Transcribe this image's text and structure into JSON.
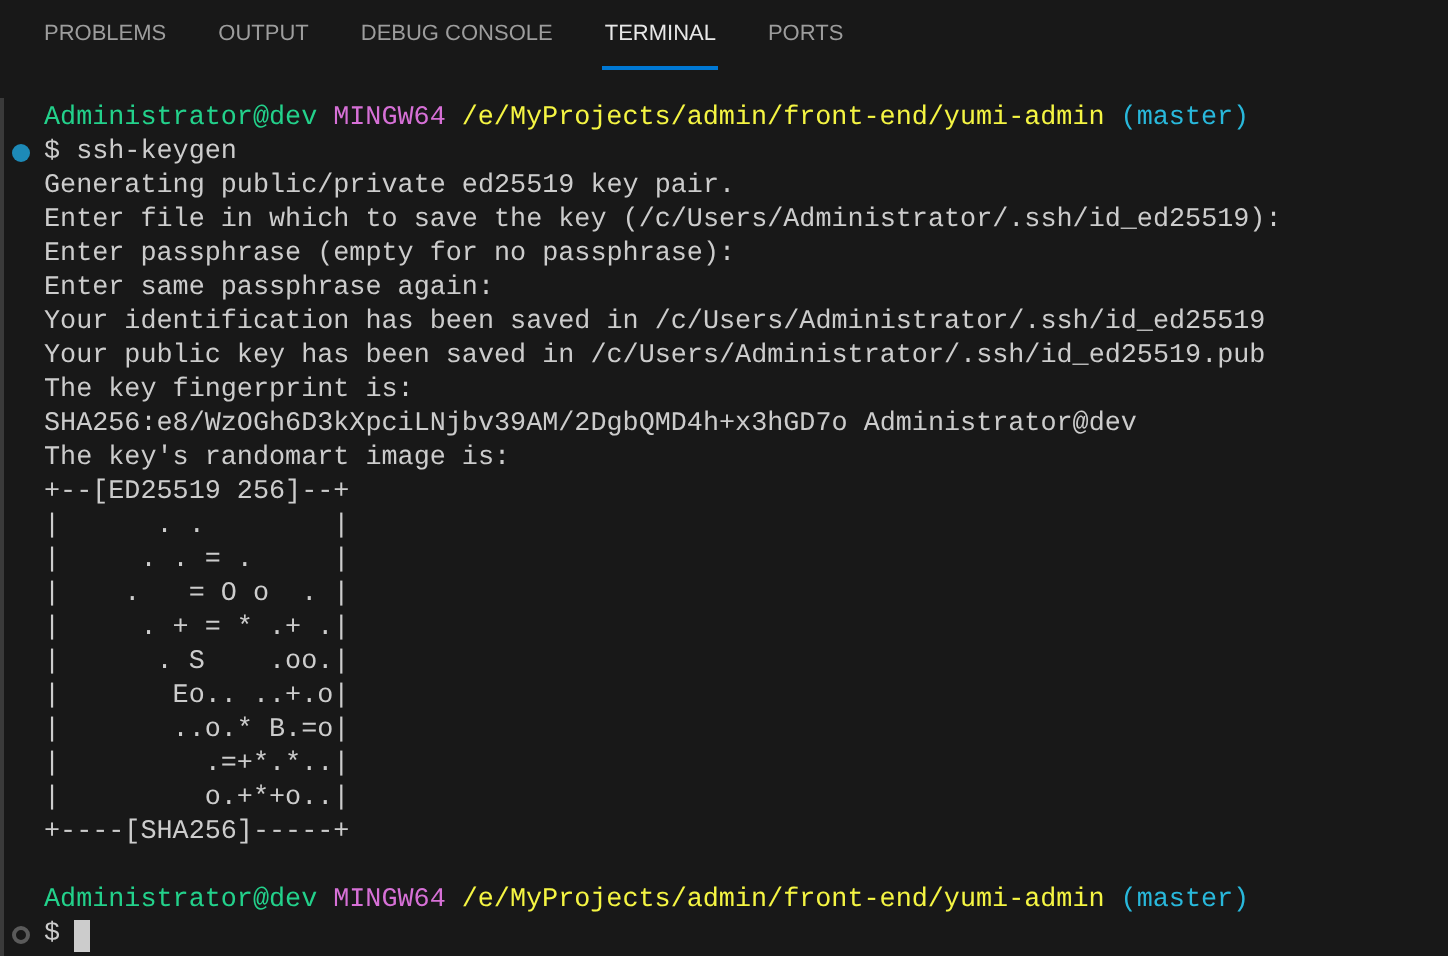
{
  "tabs": [
    {
      "label": "PROBLEMS",
      "selected": false
    },
    {
      "label": "OUTPUT",
      "selected": false
    },
    {
      "label": "DEBUG CONSOLE",
      "selected": false
    },
    {
      "label": "TERMINAL",
      "selected": true
    },
    {
      "label": "PORTS",
      "selected": false
    }
  ],
  "terminal": {
    "lines": [
      {
        "kind": "prompt",
        "segments": [
          {
            "text": "Administrator@dev",
            "color": "#23d18b"
          },
          {
            "text": "MINGW64",
            "color": "#d670d6"
          },
          {
            "text": "/e/MyProjects/admin/front-end/yumi-admin",
            "color": "#f5f543"
          },
          {
            "text": "(master)",
            "color": "#29b8db"
          }
        ]
      },
      {
        "kind": "command",
        "succeeded": true,
        "text": "$ ssh-keygen",
        "cursor": false
      },
      {
        "kind": "output",
        "text": "Generating public/private ed25519 key pair."
      },
      {
        "kind": "output",
        "text": "Enter file in which to save the key (/c/Users/Administrator/.ssh/id_ed25519):"
      },
      {
        "kind": "output",
        "text": "Enter passphrase (empty for no passphrase):"
      },
      {
        "kind": "output",
        "text": "Enter same passphrase again:"
      },
      {
        "kind": "output",
        "text": "Your identification has been saved in /c/Users/Administrator/.ssh/id_ed25519"
      },
      {
        "kind": "output",
        "text": "Your public key has been saved in /c/Users/Administrator/.ssh/id_ed25519.pub"
      },
      {
        "kind": "output",
        "text": "The key fingerprint is:"
      },
      {
        "kind": "output",
        "text": "SHA256:e8/WzOGh6D3kXpciLNjbv39AM/2DgbQMD4h+x3hGD7o Administrator@dev"
      },
      {
        "kind": "output",
        "text": "The key's randomart image is:"
      },
      {
        "kind": "output",
        "text": "+--[ED25519 256]--+"
      },
      {
        "kind": "output",
        "text": "|      . .        |"
      },
      {
        "kind": "output",
        "text": "|     . . = .     |"
      },
      {
        "kind": "output",
        "text": "|    .   = O o  . |"
      },
      {
        "kind": "output",
        "text": "|     . + = * .+ .|"
      },
      {
        "kind": "output",
        "text": "|      . S    .oo.|"
      },
      {
        "kind": "output",
        "text": "|       Eo.. ..+.o|"
      },
      {
        "kind": "output",
        "text": "|       ..o.* B.=o|"
      },
      {
        "kind": "output",
        "text": "|         .=+*.*..|"
      },
      {
        "kind": "output",
        "text": "|         o.+*+o..|"
      },
      {
        "kind": "output",
        "text": "+----[SHA256]-----+"
      },
      {
        "kind": "blank"
      },
      {
        "kind": "prompt",
        "segments": [
          {
            "text": "Administrator@dev",
            "color": "#23d18b"
          },
          {
            "text": "MINGW64",
            "color": "#d670d6"
          },
          {
            "text": "/e/MyProjects/admin/front-end/yumi-admin",
            "color": "#f5f543"
          },
          {
            "text": "(master)",
            "color": "#29b8db"
          }
        ]
      },
      {
        "kind": "command",
        "succeeded": false,
        "text": "$",
        "cursor": true
      }
    ]
  }
}
